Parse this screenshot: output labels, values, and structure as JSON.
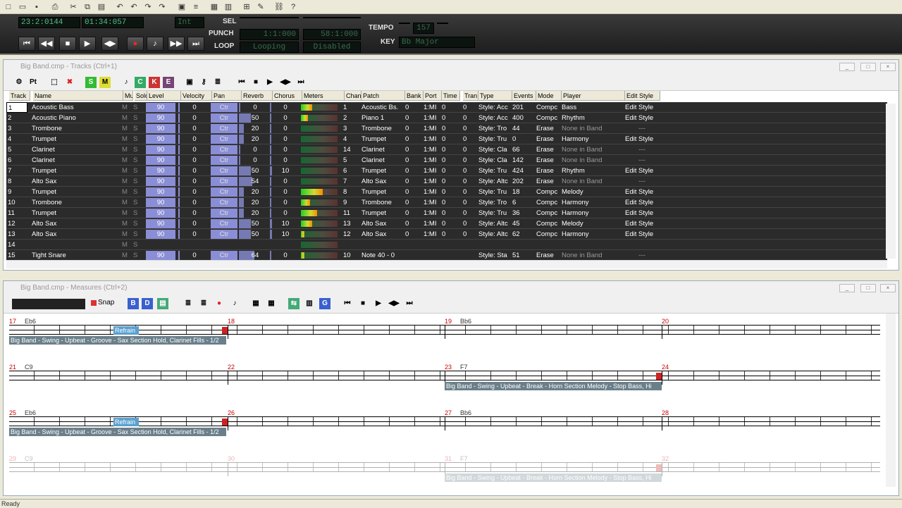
{
  "toolbar": {
    "icons": [
      "new-file-icon",
      "open-folder-icon",
      "save-icon",
      "print-icon",
      "cut-icon",
      "copy-icon",
      "paste-icon",
      "undo-icon",
      "undo2-icon",
      "redo-icon",
      "redo2-icon",
      "tracks-view-icon",
      "list-view-icon",
      "grid-view-icon",
      "measures-view-icon",
      "table-icon",
      "pencil-icon",
      "link-icon",
      "help-icon"
    ]
  },
  "transport": {
    "time_a": "23:2:0144",
    "time_b": "01:34:057",
    "int_label": "Int",
    "sel_label": "SEL",
    "punch_label": "PUNCH",
    "loop_label": "LOOP",
    "punch_start": "1:1:000",
    "punch_end": "58:1:000",
    "loop_mode": "Looping",
    "loop_state": "Disabled",
    "tempo_label": "TEMPO",
    "tempo_value": "157",
    "key_label": "KEY",
    "key_value": "Bb Major",
    "buttons": [
      "rewind-start",
      "rewind",
      "stop",
      "play",
      "ffwd",
      "record",
      "metronome",
      "fast-forward",
      "end"
    ]
  },
  "tracks_window": {
    "title": "Big Band.cmp - Tracks (Ctrl+1)",
    "columns": [
      "Track",
      "Name",
      "Mut",
      "Solo",
      "Level",
      "Velocity",
      "Pan",
      "Reverb",
      "Chorus",
      "Meters",
      "Chan",
      "Patch",
      "Bank",
      "Port",
      "Time S",
      "Tran",
      "Type",
      "Events",
      "Mode",
      "Player",
      "Edit Style"
    ],
    "rows": [
      {
        "track": "1",
        "name": "Acoustic Bass",
        "level": "90",
        "velocity": "0",
        "pan": "Ctr",
        "reverb": "0",
        "chorus": "0",
        "meter": 0.3,
        "chan": "1",
        "patch": "Acoustic Bs.",
        "bank": "0",
        "port": "1:MI",
        "ts": "0",
        "tran": "0",
        "type": "Style: Acc",
        "events": "201",
        "mode": "Compc",
        "player": "Bass",
        "edit": "Edit Style"
      },
      {
        "track": "2",
        "name": "Acoustic Piano",
        "level": "90",
        "velocity": "0",
        "pan": "Ctr",
        "reverb": "50",
        "chorus": "0",
        "meter": 0.2,
        "chan": "2",
        "patch": "Piano 1",
        "bank": "0",
        "port": "1:MI",
        "ts": "0",
        "tran": "0",
        "type": "Style: Acc",
        "events": "400",
        "mode": "Compc",
        "player": "Rhythm",
        "edit": "Edit Style"
      },
      {
        "track": "3",
        "name": "Trombone",
        "level": "90",
        "velocity": "0",
        "pan": "Ctr",
        "reverb": "20",
        "chorus": "0",
        "meter": 0,
        "chan": "3",
        "patch": "Trombone",
        "bank": "0",
        "port": "1:MI",
        "ts": "0",
        "tran": "0",
        "type": "Style: Tro",
        "events": "44",
        "mode": "Erase",
        "player": "None in Band",
        "edit": "---"
      },
      {
        "track": "4",
        "name": "Trumpet",
        "level": "90",
        "velocity": "0",
        "pan": "Ctr",
        "reverb": "20",
        "chorus": "0",
        "meter": 0,
        "chan": "4",
        "patch": "Trumpet",
        "bank": "0",
        "port": "1:MI",
        "ts": "0",
        "tran": "0",
        "type": "Style: Tru",
        "events": "0",
        "mode": "Erase",
        "player": "Harmony",
        "edit": "Edit Style"
      },
      {
        "track": "5",
        "name": "Clarinet",
        "level": "90",
        "velocity": "0",
        "pan": "Ctr",
        "reverb": "0",
        "chorus": "0",
        "meter": 0,
        "chan": "14",
        "patch": "Clarinet",
        "bank": "0",
        "port": "1:MI",
        "ts": "0",
        "tran": "0",
        "type": "Style: Cla",
        "events": "66",
        "mode": "Erase",
        "player": "None in Band",
        "edit": "---"
      },
      {
        "track": "6",
        "name": "Clarinet",
        "level": "90",
        "velocity": "0",
        "pan": "Ctr",
        "reverb": "0",
        "chorus": "0",
        "meter": 0,
        "chan": "5",
        "patch": "Clarinet",
        "bank": "0",
        "port": "1:MI",
        "ts": "0",
        "tran": "0",
        "type": "Style: Cla",
        "events": "142",
        "mode": "Erase",
        "player": "None in Band",
        "edit": "---"
      },
      {
        "track": "7",
        "name": "Trumpet",
        "level": "90",
        "velocity": "0",
        "pan": "Ctr",
        "reverb": "50",
        "chorus": "10",
        "meter": 0,
        "chan": "6",
        "patch": "Trumpet",
        "bank": "0",
        "port": "1:MI",
        "ts": "0",
        "tran": "0",
        "type": "Style: Tru",
        "events": "424",
        "mode": "Erase",
        "player": "Rhythm",
        "edit": "Edit Style"
      },
      {
        "track": "8",
        "name": "Alto Sax",
        "level": "90",
        "velocity": "0",
        "pan": "Ctr",
        "reverb": "54",
        "chorus": "0",
        "meter": 0,
        "chan": "7",
        "patch": "Alto Sax",
        "bank": "0",
        "port": "1:MI",
        "ts": "0",
        "tran": "0",
        "type": "Style: Altc",
        "events": "202",
        "mode": "Erase",
        "player": "None in Band",
        "edit": "---"
      },
      {
        "track": "9",
        "name": "Trumpet",
        "level": "90",
        "velocity": "0",
        "pan": "Ctr",
        "reverb": "20",
        "chorus": "0",
        "meter": 0.6,
        "chan": "8",
        "patch": "Trumpet",
        "bank": "0",
        "port": "1:MI",
        "ts": "0",
        "tran": "0",
        "type": "Style: Tru",
        "events": "18",
        "mode": "Compc",
        "player": "Melody",
        "edit": "Edit Style"
      },
      {
        "track": "10",
        "name": "Trombone",
        "level": "90",
        "velocity": "0",
        "pan": "Ctr",
        "reverb": "20",
        "chorus": "0",
        "meter": 0.25,
        "chan": "9",
        "patch": "Trombone",
        "bank": "0",
        "port": "1:MI",
        "ts": "0",
        "tran": "0",
        "type": "Style: Tro",
        "events": "6",
        "mode": "Compc",
        "player": "Harmony",
        "edit": "Edit Style"
      },
      {
        "track": "11",
        "name": "Trumpet",
        "level": "90",
        "velocity": "0",
        "pan": "Ctr",
        "reverb": "20",
        "chorus": "0",
        "meter": 0.45,
        "chan": "11",
        "patch": "Trumpet",
        "bank": "0",
        "port": "1:MI",
        "ts": "0",
        "tran": "0",
        "type": "Style: Tru",
        "events": "36",
        "mode": "Compc",
        "player": "Harmony",
        "edit": "Edit Style"
      },
      {
        "track": "12",
        "name": "Alto Sax",
        "level": "90",
        "velocity": "0",
        "pan": "Ctr",
        "reverb": "50",
        "chorus": "10",
        "meter": 0.3,
        "chan": "13",
        "patch": "Alto Sax",
        "bank": "0",
        "port": "1:MI",
        "ts": "0",
        "tran": "0",
        "type": "Style: Altc",
        "events": "45",
        "mode": "Compc",
        "player": "Melody",
        "edit": "Edit Style"
      },
      {
        "track": "13",
        "name": "Alto Sax",
        "level": "90",
        "velocity": "0",
        "pan": "Ctr",
        "reverb": "50",
        "chorus": "10",
        "meter": 0.1,
        "chan": "12",
        "patch": "Alto Sax",
        "bank": "0",
        "port": "1:MI",
        "ts": "0",
        "tran": "0",
        "type": "Style: Altc",
        "events": "62",
        "mode": "Compc",
        "player": "Harmony",
        "edit": "Edit Style"
      },
      {
        "track": "14",
        "name": "",
        "level": "",
        "velocity": "",
        "pan": "",
        "reverb": "",
        "chorus": "",
        "meter": 0,
        "chan": "",
        "patch": "",
        "bank": "",
        "port": "",
        "ts": "",
        "tran": "",
        "type": "",
        "events": "",
        "mode": "",
        "player": "",
        "edit": ""
      },
      {
        "track": "15",
        "name": "Tight Snare",
        "level": "90",
        "velocity": "0",
        "pan": "Ctr",
        "reverb": "64",
        "chorus": "0",
        "meter": 0.1,
        "chan": "10",
        "patch": "Note 40 - 0",
        "bank": "",
        "port": "",
        "ts": "",
        "tran": "",
        "type": "Style: Sta",
        "events": "51",
        "mode": "Erase",
        "player": "None in Band",
        "edit": "---"
      }
    ]
  },
  "measures_window": {
    "title": "Big Band.cmp - Measures (Ctrl+2)",
    "snap_label": "Snap",
    "rows": [
      {
        "measures": [
          {
            "num": "17",
            "chord": "Eb6"
          },
          {
            "num": "18",
            "chord": ""
          },
          {
            "num": "19",
            "chord": "Bb6"
          },
          {
            "num": "20",
            "chord": ""
          }
        ],
        "riff": "Refrain",
        "style": "Big Band - Swing - Upbeat - Groove - Sax Section Hold, Clarinet Fills - 1/2",
        "style_pos": "left"
      },
      {
        "measures": [
          {
            "num": "21",
            "chord": "C9"
          },
          {
            "num": "22",
            "chord": ""
          },
          {
            "num": "23",
            "chord": "F7"
          },
          {
            "num": "24",
            "chord": ""
          }
        ],
        "riff": "",
        "style": "Big Band - Swing - Upbeat - Break - Horn Section Melody - Stop Bass, Hi",
        "style_pos": "mid"
      },
      {
        "measures": [
          {
            "num": "25",
            "chord": "Eb6"
          },
          {
            "num": "26",
            "chord": ""
          },
          {
            "num": "27",
            "chord": "Bb6"
          },
          {
            "num": "28",
            "chord": ""
          }
        ],
        "riff": "Refrain",
        "style": "Big Band - Swing - Upbeat - Groove - Sax Section Hold, Clarinet Fills - 1/2",
        "style_pos": "left"
      },
      {
        "measures": [
          {
            "num": "29",
            "chord": "C9"
          },
          {
            "num": "30",
            "chord": ""
          },
          {
            "num": "31",
            "chord": "F7"
          },
          {
            "num": "32",
            "chord": ""
          }
        ],
        "riff": "",
        "style": "Big Band - Swing - Upbeat - Break - Horn Section Melody - Stop Bass, Hi",
        "style_pos": "mid"
      }
    ]
  },
  "status": {
    "text": "Ready"
  }
}
